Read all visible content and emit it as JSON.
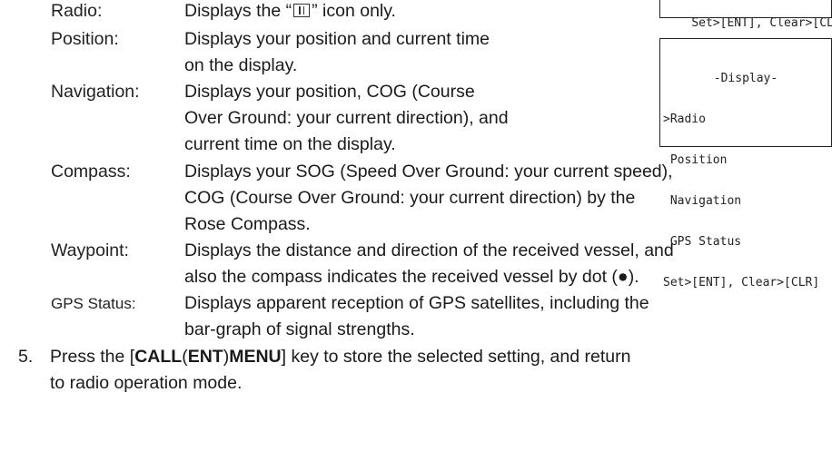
{
  "entries": [
    {
      "term": "Radio:",
      "lines": [
        "Displays the “",
        "” icon only."
      ]
    },
    {
      "term": "Position:",
      "lines": [
        "Displays your position and current time",
        "on the display."
      ]
    },
    {
      "term": "Navigation:",
      "lines": [
        "Displays your position, COG (Course",
        "Over Ground: your current direction), and",
        "current time on the display."
      ]
    },
    {
      "term": "Compass:",
      "lines": [
        "Displays your SOG (Speed Over Ground: your current speed),",
        "COG (Course Over Ground: your current direction) by the",
        "Rose Compass."
      ]
    },
    {
      "term": "Waypoint:",
      "lines": [
        "Displays the distance and direction of the received vessel, and",
        "also the compass indicates the received vessel by dot (●)."
      ]
    },
    {
      "term": "GPS Status:",
      "lines": [
        "Displays apparent reception of GPS satellites, including the",
        "bar-graph of signal strengths."
      ]
    }
  ],
  "step5": {
    "number": "5.",
    "pre": "Press the [",
    "call": "CALL",
    "ent": "ENT",
    "menu": "MENU",
    "post": "] key to store the selected setting, and return",
    "line2": "to radio operation mode."
  },
  "lcd_top": {
    "text": "Set>[ENT], Clear>[CLR]"
  },
  "lcd_main": {
    "title": "-Display-",
    "items": [
      ">Radio",
      " Position",
      " Navigation",
      " GPS Status"
    ],
    "footer": "Set>[ENT], Clear>[CLR]"
  }
}
